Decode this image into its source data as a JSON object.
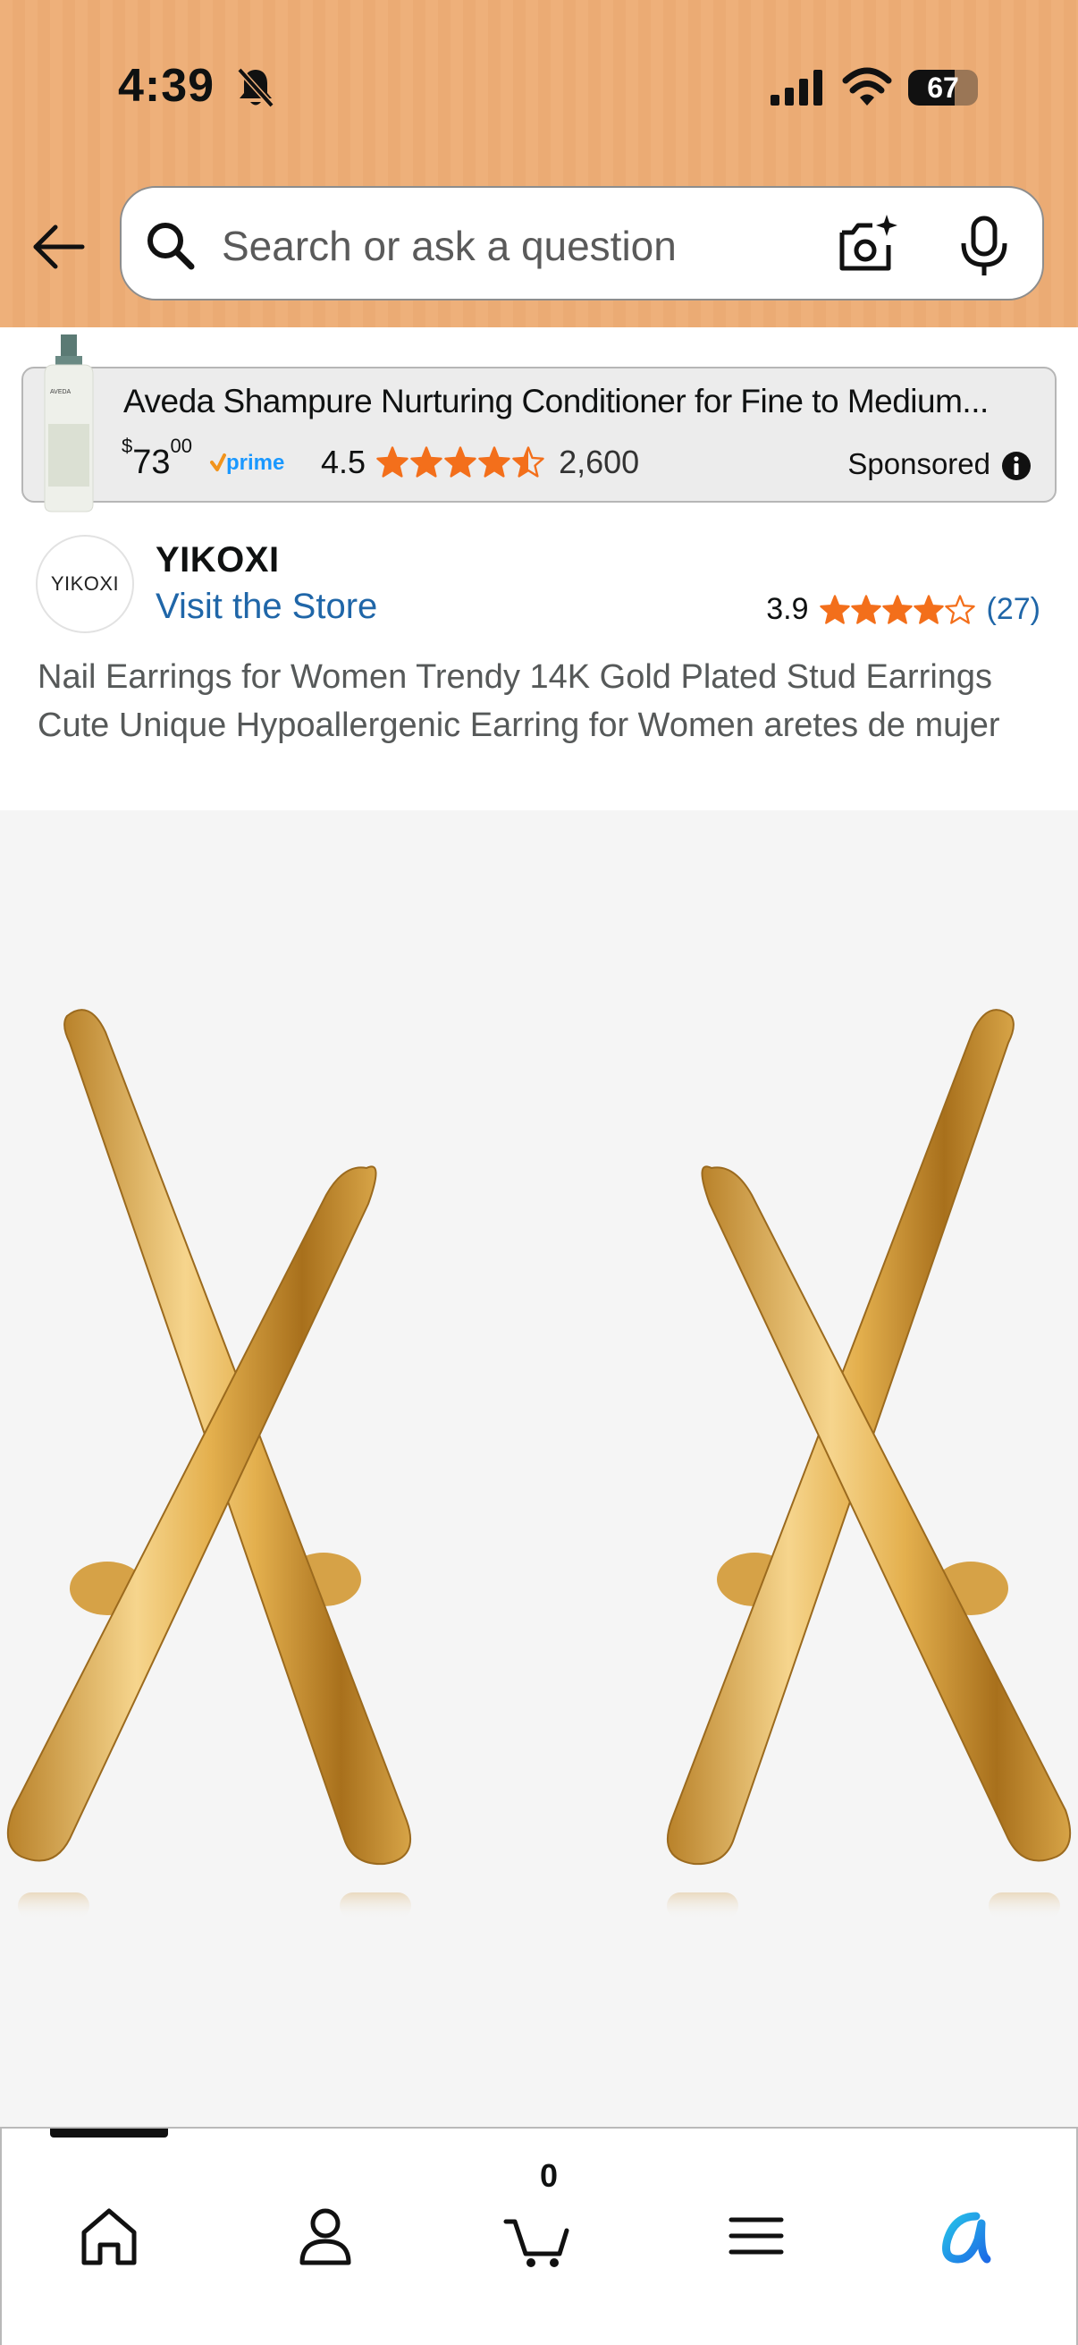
{
  "status_bar": {
    "time": "4:39",
    "battery": "67",
    "battery_level": 0.67
  },
  "search": {
    "placeholder": "Search or ask a question"
  },
  "ad": {
    "title": "Aveda Shampure Nurturing Conditioner for Fine to Medium...",
    "price_symbol": "$",
    "price_whole": "73",
    "price_fraction": "00",
    "rating": "4.5",
    "stars": 4.5,
    "review_count": "2,600",
    "sponsored_label": "Sponsored",
    "image_brand": "AVEDA"
  },
  "brand": {
    "logo_text": "YIKOXI",
    "name": "YIKOXI",
    "visit_store": "Visit the Store",
    "rating": "3.9",
    "stars": 3.9,
    "rating_count": "(27)"
  },
  "product": {
    "title": "Nail Earrings for Women Trendy 14K Gold Plated Stud Earrings Cute Unique Hypoallergenic Earring for Women aretes de mujer"
  },
  "nav": {
    "cart_count": "0"
  },
  "colors": {
    "header": "#eeb07a",
    "link": "#1f66a8",
    "star": "#f36f1b",
    "prime": "#1a98ff",
    "gold": "#d9a53a"
  }
}
